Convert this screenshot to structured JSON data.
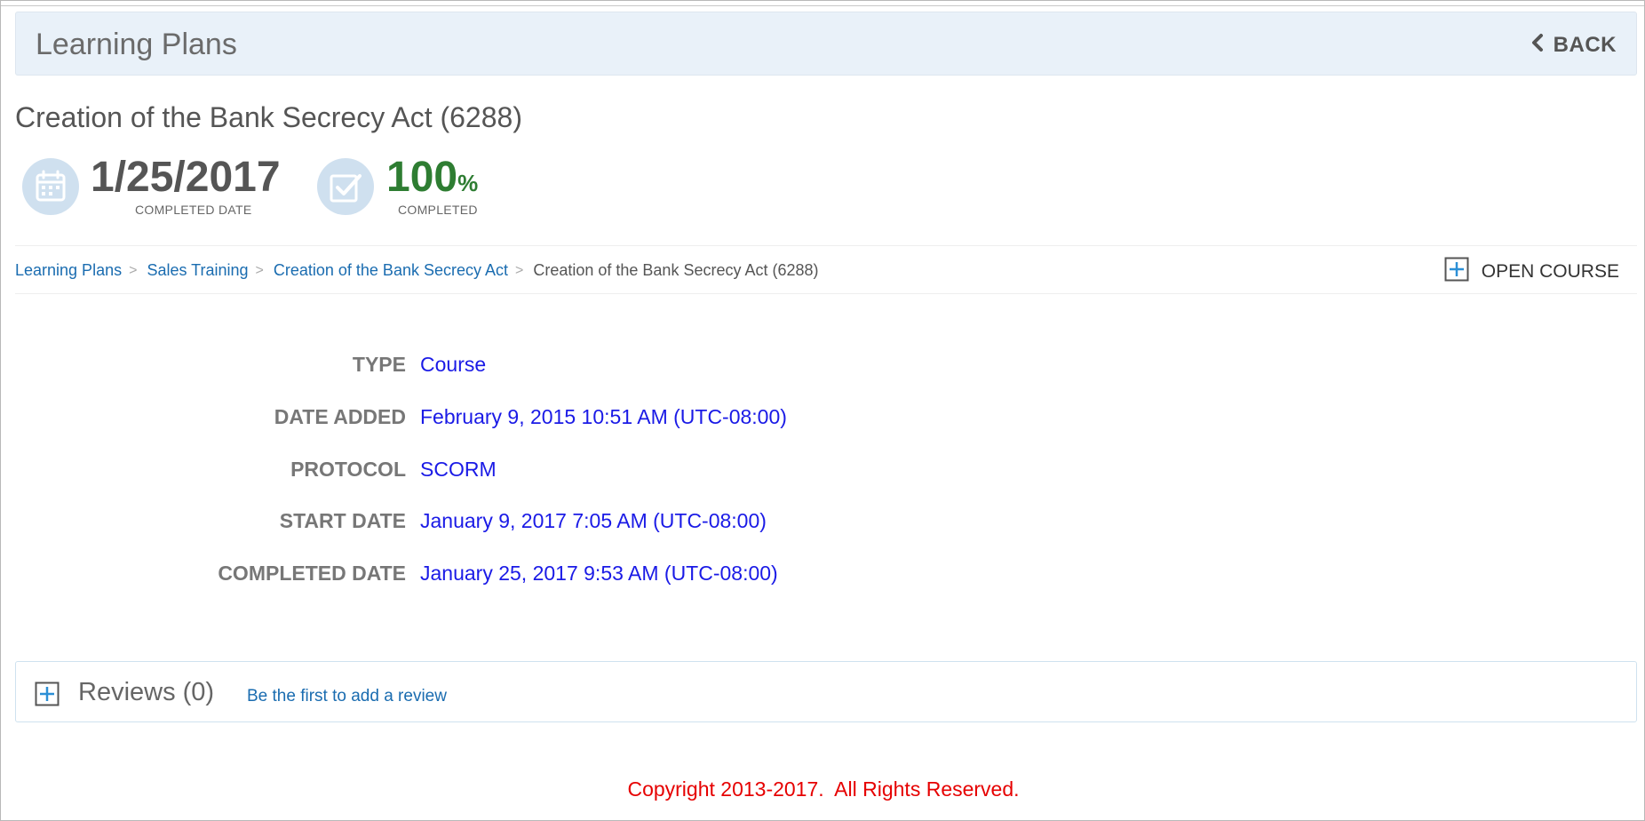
{
  "header": {
    "title": "Learning Plans",
    "back_label": "BACK"
  },
  "course": {
    "title": "Creation of the Bank Secrecy Act (6288)"
  },
  "stats": {
    "completed_date": {
      "value": "1/25/2017",
      "label": "COMPLETED DATE",
      "icon": "calendar-icon"
    },
    "completion": {
      "value": "100",
      "unit": "%",
      "label": "COMPLETED",
      "icon": "checkbox-icon",
      "color": "#2e7d32"
    }
  },
  "breadcrumb": {
    "items": [
      {
        "label": "Learning Plans"
      },
      {
        "label": "Sales Training"
      },
      {
        "label": "Creation of the Bank Secrecy Act"
      }
    ],
    "separator": ">",
    "current": "Creation of the Bank Secrecy Act (6288)"
  },
  "actions": {
    "open_course_label": "OPEN COURSE",
    "icon": "plus-square-icon"
  },
  "details": [
    {
      "label": "TYPE",
      "value": "Course"
    },
    {
      "label": "DATE ADDED",
      "value": "February 9, 2015 10:51 AM (UTC-08:00)"
    },
    {
      "label": "PROTOCOL",
      "value": "SCORM"
    },
    {
      "label": "START DATE",
      "value": "January 9, 2017 7:05 AM (UTC-08:00)"
    },
    {
      "label": "COMPLETED DATE",
      "value": "January 25, 2017 9:53 AM (UTC-08:00)"
    }
  ],
  "reviews": {
    "title": "Reviews (0)",
    "add_link": "Be the first to add a review",
    "icon": "plus-square-icon"
  },
  "footer": {
    "copyright": "Copyright 2013-2017.  All Rights Reserved."
  },
  "colors": {
    "header_bg": "#e9f1f9",
    "link": "#1a6cb0",
    "value": "#1a1ae6",
    "success": "#2e7d32",
    "copyright": "#e60000",
    "icon_circle": "#cfe0ef"
  }
}
